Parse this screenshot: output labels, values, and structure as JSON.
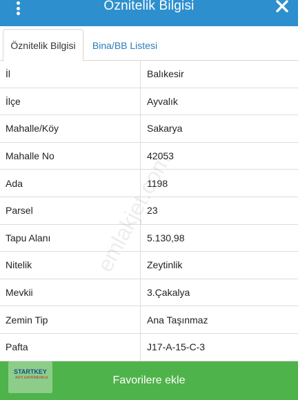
{
  "header": {
    "title": "Öznitelik Bilgisi",
    "menu_icon": "vertical-dots-icon",
    "close_icon": "close-icon"
  },
  "tabs": [
    {
      "label": "Öznitelik Bilgisi",
      "active": true
    },
    {
      "label": "Bina/BB Listesi",
      "active": false
    }
  ],
  "rows": [
    {
      "key": "İl",
      "value": "Balıkesir"
    },
    {
      "key": "İlçe",
      "value": "Ayvalık"
    },
    {
      "key": "Mahalle/Köy",
      "value": "Sakarya"
    },
    {
      "key": "Mahalle No",
      "value": "42053"
    },
    {
      "key": "Ada",
      "value": "1198"
    },
    {
      "key": "Parsel",
      "value": "23"
    },
    {
      "key": "Tapu Alanı",
      "value": "5.130,98"
    },
    {
      "key": "Nitelik",
      "value": "Zeytinlik"
    },
    {
      "key": "Mevkii",
      "value": "3.Çakalya"
    },
    {
      "key": "Zemin Tip",
      "value": "Ana Taşınmaz"
    },
    {
      "key": "Pafta",
      "value": "J17-A-15-C-3"
    }
  ],
  "watermark": "emlakjet.com",
  "favorite_button": {
    "label": "Favorilere ekle"
  },
  "logo": {
    "name": "STARTKEY",
    "sub": "ARTI GAYRİMENKUL"
  },
  "colors": {
    "header": "#2e8fce",
    "tab_link": "#2b7bb9",
    "favorite_bar": "#4fb34b"
  }
}
